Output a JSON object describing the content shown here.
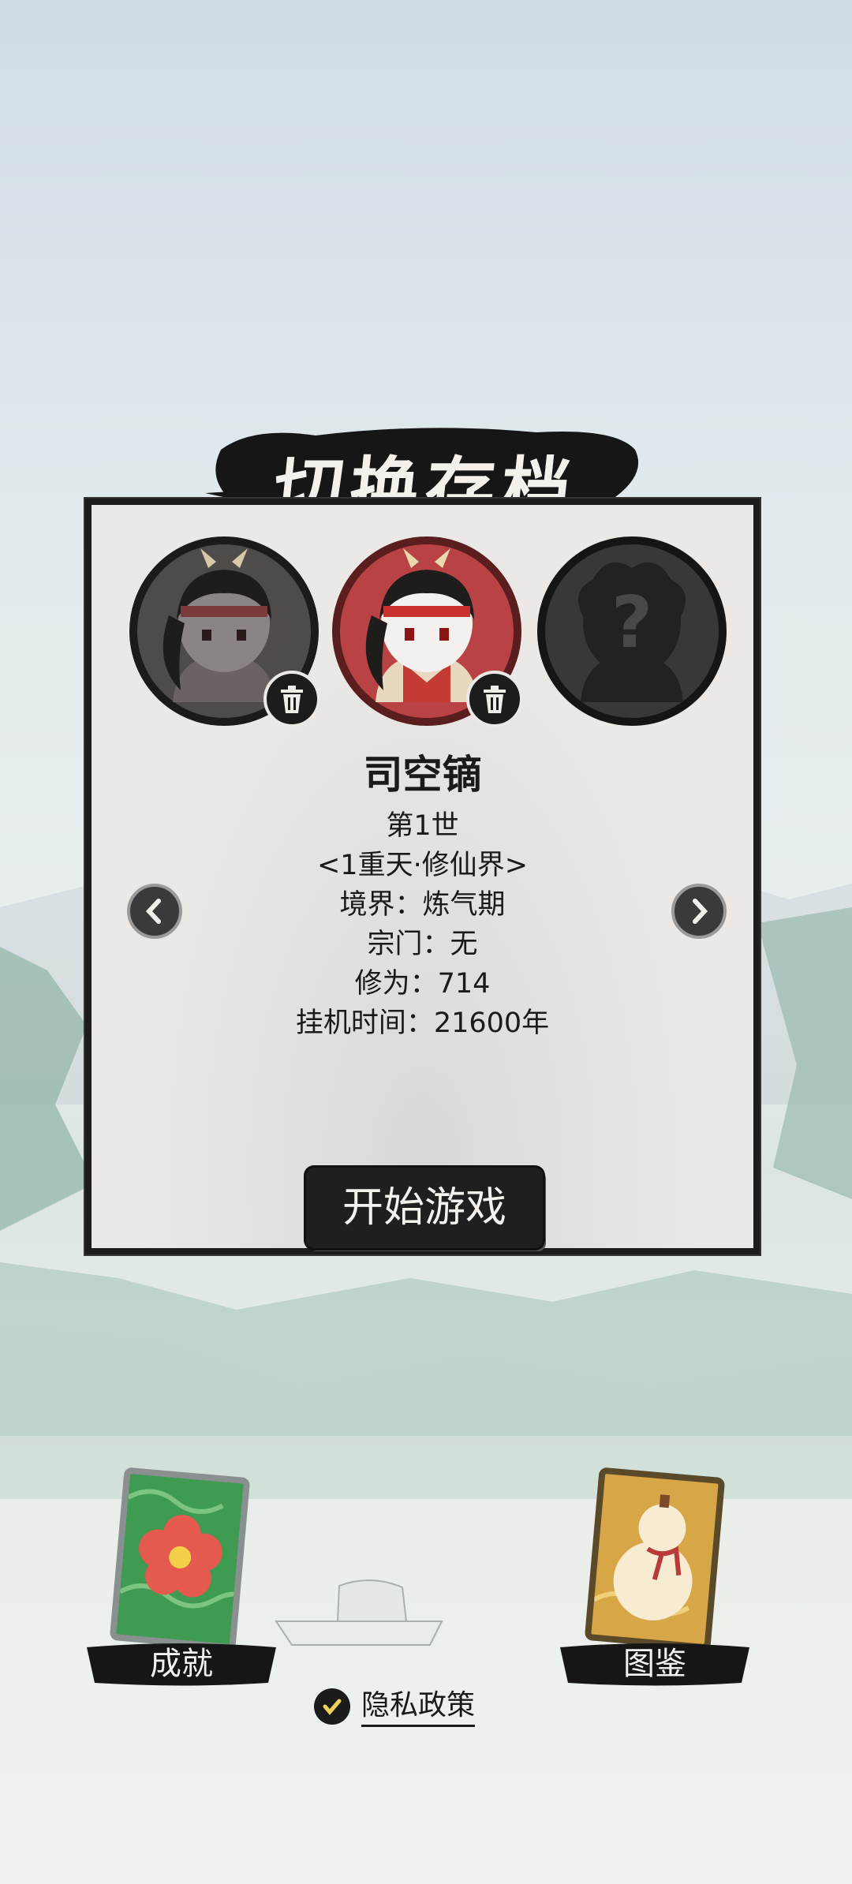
{
  "screen": {
    "title": "切换存档"
  },
  "slots": [
    {
      "id": "slot-1",
      "state": "inactive",
      "deletable": true
    },
    {
      "id": "slot-2",
      "state": "selected",
      "deletable": true
    },
    {
      "id": "slot-3",
      "state": "empty",
      "symbol": "?"
    }
  ],
  "character": {
    "name": "司空镝",
    "generation": "第1世",
    "world": "<1重天·修仙界>",
    "realm": "境界：炼气期",
    "sect": "宗门：无",
    "cultivation": "修为：714",
    "idle_time": "挂机时间：21600年"
  },
  "actions": {
    "start_label": "开始游戏"
  },
  "bottom": {
    "achievements_label": "成就",
    "atlas_label": "图鉴",
    "privacy_label": "隐私政策",
    "privacy_checked": true
  },
  "colors": {
    "panel_bg": "#ebe8e5",
    "ink": "#1c1c1c",
    "selected_avatar": "#b84244",
    "achievement_card": "#3f9a52",
    "atlas_card": "#d7a647"
  },
  "icons": [
    "trash-icon",
    "chevron-left-icon",
    "chevron-right-icon",
    "check-icon",
    "flower-icon",
    "gourd-icon"
  ]
}
